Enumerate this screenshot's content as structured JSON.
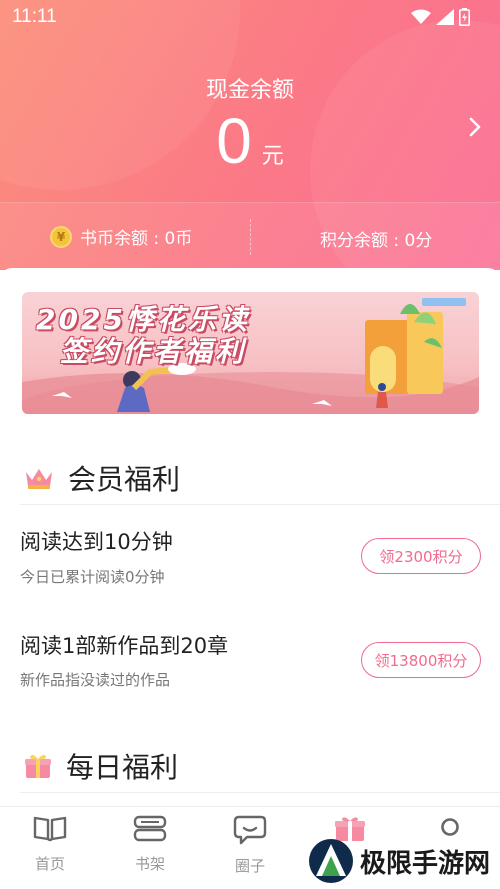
{
  "status": {
    "time": "11:11"
  },
  "balance": {
    "label": "现金余额",
    "amount": "0",
    "unit": "元"
  },
  "sub": {
    "coins": "书币余额 : 0币",
    "points": "积分余额 : 0分",
    "coin_glyph": "¥"
  },
  "banner": {
    "line1": "2025悸花乐读",
    "line2": "签约作者福利"
  },
  "member_section": {
    "title": "会员福利",
    "icon": "crown-icon"
  },
  "tasks": [
    {
      "title": "阅读达到10分钟",
      "desc": "今日已累计阅读0分钟",
      "button": "领2300积分"
    },
    {
      "title": "阅读1部新作品到20章",
      "desc": "新作品指没读过的作品",
      "button": "领13800积分"
    }
  ],
  "daily_section": {
    "title": "每日福利",
    "icon": "gift-icon"
  },
  "tabs": [
    {
      "label": "首页",
      "icon": "book-open-icon"
    },
    {
      "label": "书架",
      "icon": "bookshelf-icon"
    },
    {
      "label": "圈子",
      "icon": "chat-icon"
    },
    {
      "label": "",
      "icon": "gift-icon"
    },
    {
      "label": "",
      "icon": "profile-icon"
    }
  ],
  "watermark": {
    "text": "极限手游网"
  },
  "colors": {
    "accent": "#f06b8d",
    "header_start": "#fb8f7a",
    "header_end": "#fb6d94"
  }
}
